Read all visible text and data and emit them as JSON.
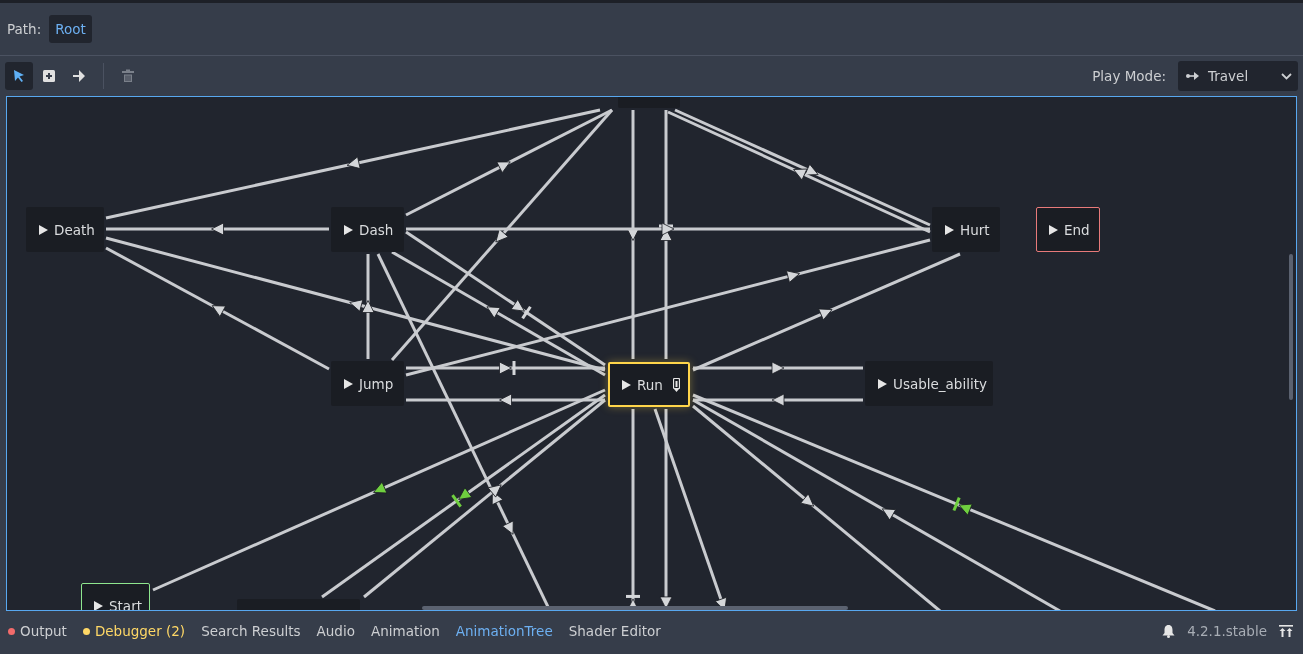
{
  "path_bar": {
    "label": "Path:",
    "crumbs": [
      {
        "label": "Root",
        "selected": true
      }
    ]
  },
  "toolbar": {
    "tools": [
      {
        "kind": "select",
        "selected": true,
        "disabled": false
      },
      {
        "kind": "create",
        "selected": false,
        "disabled": false
      },
      {
        "kind": "connect",
        "selected": false,
        "disabled": false
      },
      {
        "kind": "delete",
        "selected": false,
        "disabled": true
      }
    ],
    "play_mode": {
      "label": "Play Mode:",
      "value": "Travel"
    }
  },
  "graph": {
    "nodes": [
      {
        "label": "Death",
        "kind": "state",
        "selected": false,
        "editable": false
      },
      {
        "label": "Dash",
        "kind": "state",
        "selected": false,
        "editable": false
      },
      {
        "label": "Hurt",
        "kind": "state",
        "selected": false,
        "editable": false
      },
      {
        "label": "End",
        "kind": "end",
        "selected": false,
        "editable": false
      },
      {
        "label": "Jump",
        "kind": "state",
        "selected": false,
        "editable": false
      },
      {
        "label": "Run",
        "kind": "state",
        "selected": true,
        "editable": true
      },
      {
        "label": "Usable_ability",
        "kind": "state",
        "selected": false,
        "editable": false
      },
      {
        "label": "Start",
        "kind": "start",
        "selected": false,
        "editable": false
      },
      {
        "kind": "blank",
        "selected": false,
        "editable": false
      },
      {
        "kind": "blank",
        "selected": false,
        "editable": false
      }
    ]
  },
  "bottom_panel": {
    "tabs": [
      {
        "label": "Output",
        "kind": "error",
        "selected": false
      },
      {
        "label": "Debugger (2)",
        "kind": "warning",
        "selected": false
      },
      {
        "label": "Search Results",
        "kind": "plain",
        "selected": false
      },
      {
        "label": "Audio",
        "kind": "plain",
        "selected": false
      },
      {
        "label": "Animation",
        "kind": "plain",
        "selected": false
      },
      {
        "label": "AnimationTree",
        "kind": "plain",
        "selected": true
      },
      {
        "label": "Shader Editor",
        "kind": "plain",
        "selected": false
      }
    ],
    "version": "4.2.1.stable"
  }
}
